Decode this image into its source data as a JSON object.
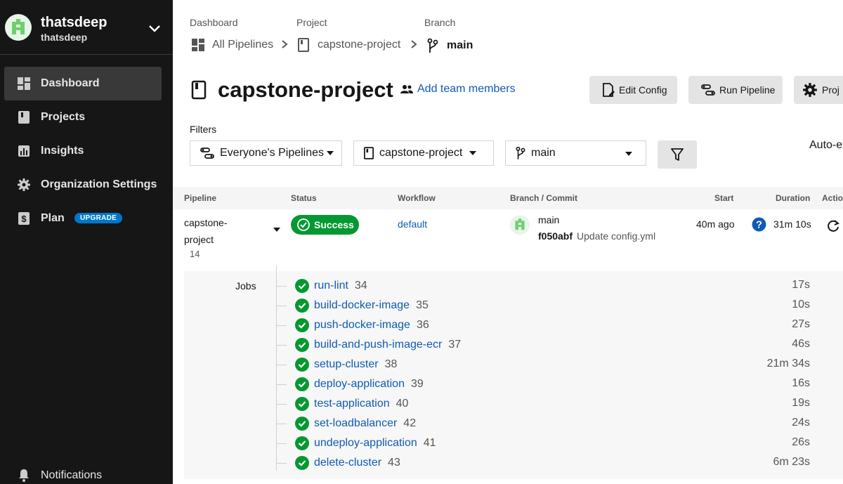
{
  "org": {
    "name": "thatsdeep",
    "sub": "thatsdeep"
  },
  "sidebar": {
    "items": [
      {
        "label": "Dashboard",
        "icon": "dashboard-icon",
        "active": true
      },
      {
        "label": "Projects",
        "icon": "projects-icon"
      },
      {
        "label": "Insights",
        "icon": "insights-icon"
      },
      {
        "label": "Organization Settings",
        "icon": "gear-icon"
      },
      {
        "label": "Plan",
        "icon": "dollar-icon",
        "badge": "UPGRADE"
      }
    ],
    "notifications": "Notifications"
  },
  "breadcrumb": {
    "dashboard_heading": "Dashboard",
    "dashboard_value": "All Pipelines",
    "project_heading": "Project",
    "project_value": "capstone-project",
    "branch_heading": "Branch",
    "branch_value": "main"
  },
  "header": {
    "title": "capstone-project",
    "add_team": "Add team members",
    "edit_config": "Edit Config",
    "run_pipeline": "Run Pipeline",
    "project_settings": "Proj"
  },
  "filters": {
    "label": "Filters",
    "pipelines": "Everyone's Pipelines",
    "project": "capstone-project",
    "branch": "main",
    "auto_expand": "Auto-ex"
  },
  "table": {
    "headers": {
      "pipeline": "Pipeline",
      "status": "Status",
      "workflow": "Workflow",
      "branch_commit": "Branch / Commit",
      "start": "Start",
      "duration": "Duration",
      "actions": "Actio"
    },
    "row": {
      "pipeline_line1": "capstone-",
      "pipeline_line2": "project",
      "pipeline_num": "14",
      "status": "Success",
      "workflow": "default",
      "branch": "main",
      "commit_hash": "f050abf",
      "commit_msg": "Update config.yml",
      "start": "40m ago",
      "duration": "31m 10s"
    },
    "jobs_label": "Jobs",
    "jobs": [
      {
        "name": "run-lint",
        "num": "34",
        "duration": "17s"
      },
      {
        "name": "build-docker-image",
        "num": "35",
        "duration": "10s"
      },
      {
        "name": "push-docker-image",
        "num": "36",
        "duration": "27s"
      },
      {
        "name": "build-and-push-image-ecr",
        "num": "37",
        "duration": "46s"
      },
      {
        "name": "setup-cluster",
        "num": "38",
        "duration": "21m 34s"
      },
      {
        "name": "deploy-application",
        "num": "39",
        "duration": "16s"
      },
      {
        "name": "test-application",
        "num": "40",
        "duration": "19s"
      },
      {
        "name": "set-loadbalancer",
        "num": "42",
        "duration": "24s"
      },
      {
        "name": "undeploy-application",
        "num": "41",
        "duration": "26s"
      },
      {
        "name": "delete-cluster",
        "num": "43",
        "duration": "6m 23s"
      }
    ]
  },
  "colors": {
    "sidebar_bg": "#161616",
    "success": "#039930",
    "link": "#0f5ab4",
    "badge": "#0078ca"
  }
}
